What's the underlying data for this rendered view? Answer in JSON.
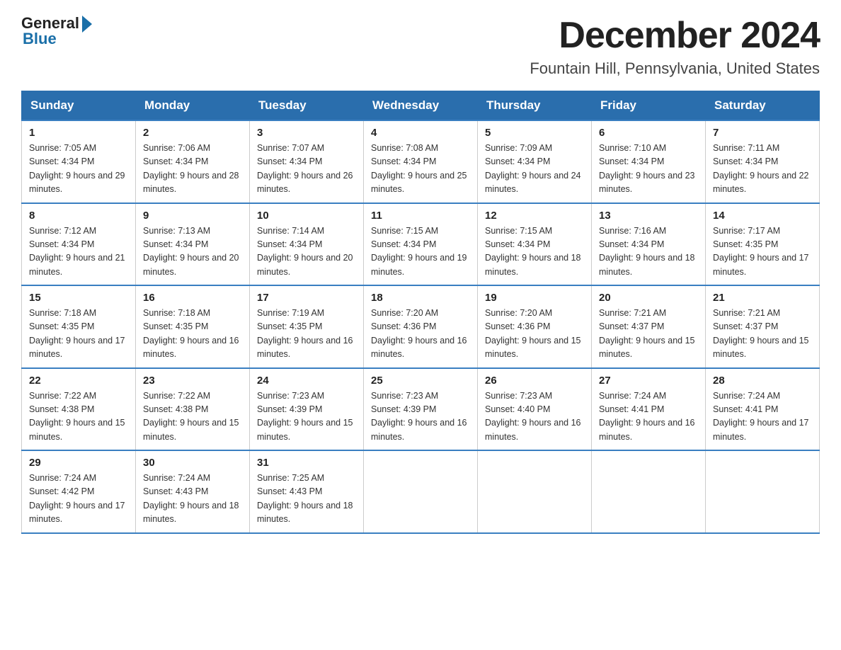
{
  "logo": {
    "general": "General",
    "blue": "Blue"
  },
  "title": "December 2024",
  "subtitle": "Fountain Hill, Pennsylvania, United States",
  "weekdays": [
    "Sunday",
    "Monday",
    "Tuesday",
    "Wednesday",
    "Thursday",
    "Friday",
    "Saturday"
  ],
  "weeks": [
    [
      {
        "day": "1",
        "sunrise": "7:05 AM",
        "sunset": "4:34 PM",
        "daylight": "9 hours and 29 minutes."
      },
      {
        "day": "2",
        "sunrise": "7:06 AM",
        "sunset": "4:34 PM",
        "daylight": "9 hours and 28 minutes."
      },
      {
        "day": "3",
        "sunrise": "7:07 AM",
        "sunset": "4:34 PM",
        "daylight": "9 hours and 26 minutes."
      },
      {
        "day": "4",
        "sunrise": "7:08 AM",
        "sunset": "4:34 PM",
        "daylight": "9 hours and 25 minutes."
      },
      {
        "day": "5",
        "sunrise": "7:09 AM",
        "sunset": "4:34 PM",
        "daylight": "9 hours and 24 minutes."
      },
      {
        "day": "6",
        "sunrise": "7:10 AM",
        "sunset": "4:34 PM",
        "daylight": "9 hours and 23 minutes."
      },
      {
        "day": "7",
        "sunrise": "7:11 AM",
        "sunset": "4:34 PM",
        "daylight": "9 hours and 22 minutes."
      }
    ],
    [
      {
        "day": "8",
        "sunrise": "7:12 AM",
        "sunset": "4:34 PM",
        "daylight": "9 hours and 21 minutes."
      },
      {
        "day": "9",
        "sunrise": "7:13 AM",
        "sunset": "4:34 PM",
        "daylight": "9 hours and 20 minutes."
      },
      {
        "day": "10",
        "sunrise": "7:14 AM",
        "sunset": "4:34 PM",
        "daylight": "9 hours and 20 minutes."
      },
      {
        "day": "11",
        "sunrise": "7:15 AM",
        "sunset": "4:34 PM",
        "daylight": "9 hours and 19 minutes."
      },
      {
        "day": "12",
        "sunrise": "7:15 AM",
        "sunset": "4:34 PM",
        "daylight": "9 hours and 18 minutes."
      },
      {
        "day": "13",
        "sunrise": "7:16 AM",
        "sunset": "4:34 PM",
        "daylight": "9 hours and 18 minutes."
      },
      {
        "day": "14",
        "sunrise": "7:17 AM",
        "sunset": "4:35 PM",
        "daylight": "9 hours and 17 minutes."
      }
    ],
    [
      {
        "day": "15",
        "sunrise": "7:18 AM",
        "sunset": "4:35 PM",
        "daylight": "9 hours and 17 minutes."
      },
      {
        "day": "16",
        "sunrise": "7:18 AM",
        "sunset": "4:35 PM",
        "daylight": "9 hours and 16 minutes."
      },
      {
        "day": "17",
        "sunrise": "7:19 AM",
        "sunset": "4:35 PM",
        "daylight": "9 hours and 16 minutes."
      },
      {
        "day": "18",
        "sunrise": "7:20 AM",
        "sunset": "4:36 PM",
        "daylight": "9 hours and 16 minutes."
      },
      {
        "day": "19",
        "sunrise": "7:20 AM",
        "sunset": "4:36 PM",
        "daylight": "9 hours and 15 minutes."
      },
      {
        "day": "20",
        "sunrise": "7:21 AM",
        "sunset": "4:37 PM",
        "daylight": "9 hours and 15 minutes."
      },
      {
        "day": "21",
        "sunrise": "7:21 AM",
        "sunset": "4:37 PM",
        "daylight": "9 hours and 15 minutes."
      }
    ],
    [
      {
        "day": "22",
        "sunrise": "7:22 AM",
        "sunset": "4:38 PM",
        "daylight": "9 hours and 15 minutes."
      },
      {
        "day": "23",
        "sunrise": "7:22 AM",
        "sunset": "4:38 PM",
        "daylight": "9 hours and 15 minutes."
      },
      {
        "day": "24",
        "sunrise": "7:23 AM",
        "sunset": "4:39 PM",
        "daylight": "9 hours and 15 minutes."
      },
      {
        "day": "25",
        "sunrise": "7:23 AM",
        "sunset": "4:39 PM",
        "daylight": "9 hours and 16 minutes."
      },
      {
        "day": "26",
        "sunrise": "7:23 AM",
        "sunset": "4:40 PM",
        "daylight": "9 hours and 16 minutes."
      },
      {
        "day": "27",
        "sunrise": "7:24 AM",
        "sunset": "4:41 PM",
        "daylight": "9 hours and 16 minutes."
      },
      {
        "day": "28",
        "sunrise": "7:24 AM",
        "sunset": "4:41 PM",
        "daylight": "9 hours and 17 minutes."
      }
    ],
    [
      {
        "day": "29",
        "sunrise": "7:24 AM",
        "sunset": "4:42 PM",
        "daylight": "9 hours and 17 minutes."
      },
      {
        "day": "30",
        "sunrise": "7:24 AM",
        "sunset": "4:43 PM",
        "daylight": "9 hours and 18 minutes."
      },
      {
        "day": "31",
        "sunrise": "7:25 AM",
        "sunset": "4:43 PM",
        "daylight": "9 hours and 18 minutes."
      },
      null,
      null,
      null,
      null
    ]
  ]
}
